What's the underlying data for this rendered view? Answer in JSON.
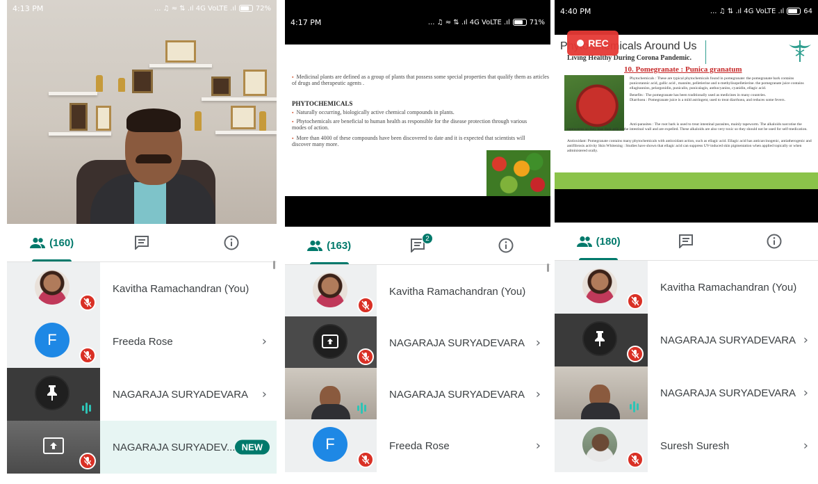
{
  "phones": [
    {
      "status": {
        "time": "4:13 PM",
        "network": "... ♫ ≈ ⇅ .ıl 4G VoLTE .ıl",
        "battery": "72%"
      },
      "tabs": {
        "people_count": "(160)",
        "chat_badge": "",
        "active": "people"
      },
      "participants": [
        {
          "name": "Kavitha Ramachandran (You)",
          "avatar": "photo",
          "status": "muted",
          "chevron": false
        },
        {
          "name": "Freeda Rose",
          "avatar": "F",
          "status": "muted",
          "chevron": true
        },
        {
          "name": "NAGARAJA SURYADEVARA",
          "avatar": "pin-icon",
          "status": "speaking",
          "chevron": true
        },
        {
          "name": "NAGARAJA SURYADEV...",
          "avatar": "present-icon",
          "status": "muted",
          "badge": "NEW"
        }
      ]
    },
    {
      "status": {
        "time": "4:17 PM",
        "network": "... ♫ ≈ ⇅ .ıl 4G VoLTE .ıl",
        "battery": "71%"
      },
      "tabs": {
        "people_count": "(163)",
        "chat_badge": "2",
        "active": "people"
      },
      "slide": {
        "intro": "Medicinal plants are defined as a group of plants that possess some special properties that qualify them as articles of drugs and therapeutic agents .",
        "heading": "PHYTOCHEMICALS",
        "bullets": [
          "Naturally occurring, biologically active chemical compounds in plants.",
          "Phytochemicals are beneficial to human health as responsible for the disease protection through various modes of action.",
          "More than 4000 of these compounds have been discovered to date and it is expected that scientists will discover many more."
        ]
      },
      "participants": [
        {
          "name": "Kavitha Ramachandran (You)",
          "avatar": "photo",
          "status": "muted"
        },
        {
          "name": "NAGARAJA SURYADEVARA",
          "avatar": "present-icon",
          "status": "muted"
        },
        {
          "name": "NAGARAJA SURYADEVARA",
          "avatar": "camera",
          "status": "speaking"
        },
        {
          "name": "Freeda Rose",
          "avatar": "F",
          "status": "muted"
        }
      ]
    },
    {
      "status": {
        "time": "4:40 PM",
        "network": "... ♫ ⇅ .ıl 4G VoLTE .ıl",
        "battery": "64"
      },
      "rec_label": "REC",
      "tabs": {
        "people_count": "(180)",
        "chat_badge": "",
        "active": "people"
      },
      "slide": {
        "title": "Phyto-chemicals Around Us",
        "subtitle": "Living Healthy During Corona Pandemic.",
        "heading": "10. Pomegranate : Punica granatum",
        "p1": "Phytochemicals : These are typical phytochemicals found in pomegranate: the pomegranate bark contains punicotannic acid, gallic acid , mannite, pelletierine and n-methylisopelletierine. the pomegranate juice contains ellagitannins, pelargonidin, punicalin, punicalagin, anthocyanins, cyanidin, ellagic acid.",
        "p2": "Benefits : The pomegranate has been traditionally used as medicines in many countries.",
        "p3": "Diarrhoea : Pomegranate juice is a mild astringent, used to treat diarrhoea, and reduces some fevers.",
        "p4": "Anti-parasites : The root bark is used to treat intestinal parasites, mainly tapeworm. The alkaloids narcotise the tapeworms so they lose their grip to the intestinal wall and are expelled. These alkaloids are also very toxic so they should not be used for self-medication.",
        "p5": "Antioxidant: Pomegranate contains many phytochemicals with antioxidant action, such as ellagic acid. Ellagic acid has anticarcinogenic, antiatherogenic and antifibrosis activity Skin Whitening : Studies have shown that ellagic acid can suppress UV-induced skin pigmentation when applied topically or when administered orally."
      },
      "participants": [
        {
          "name": "Kavitha Ramachandran (You)",
          "avatar": "photo",
          "status": "muted"
        },
        {
          "name": "NAGARAJA SURYADEVARA",
          "avatar": "pin-icon",
          "status": "muted"
        },
        {
          "name": "NAGARAJA SURYADEVARA",
          "avatar": "camera",
          "status": "speaking"
        },
        {
          "name": "Suresh Suresh",
          "avatar": "photo-suresh",
          "status": "muted"
        }
      ]
    }
  ],
  "colors": {
    "accent": "#00796b",
    "mute": "#d93025",
    "avatar_f": "#1e88e5",
    "rec": "#e53935",
    "slide_heading": "#c62828",
    "slide_green": "#8bc34a"
  }
}
